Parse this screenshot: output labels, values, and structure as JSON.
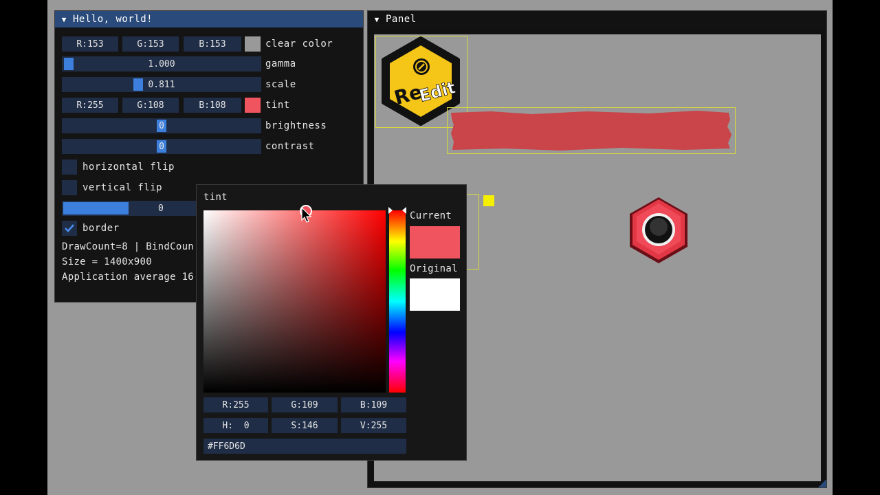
{
  "window1": {
    "title": "Hello, world!",
    "clear_color": {
      "r": "R:153",
      "g": "G:153",
      "b": "B:153",
      "label": "clear color",
      "swatch": "#999999"
    },
    "gamma": {
      "value": "1.000",
      "label": "gamma",
      "fraction": 0.0
    },
    "scale": {
      "value": "0.811",
      "label": "scale",
      "fraction": 0.39
    },
    "tint": {
      "r": "R:255",
      "g": "G:108",
      "b": "B:108",
      "label": "tint",
      "swatch": "#f0555f"
    },
    "brightness": {
      "value": "0",
      "label": "brightness",
      "fraction": 0.5
    },
    "contrast": {
      "value": "0",
      "label": "contrast",
      "fraction": 0.5
    },
    "horizontal_flip": {
      "label": "horizontal flip",
      "checked": false
    },
    "vertical_flip": {
      "label": "vertical flip",
      "checked": false
    },
    "progress": {
      "value": "0",
      "fraction": 0.33
    },
    "border": {
      "label": "border",
      "checked": true
    },
    "drawcount": "DrawCount=8 | BindCoun",
    "size": "Size = 1400x900",
    "app_avg": "Application average 16"
  },
  "window2": {
    "title": "Panel",
    "logo": {
      "text1": "Re",
      "text2": "Edit"
    }
  },
  "picker": {
    "title": "tint",
    "current_label": "Current",
    "original_label": "Original",
    "current_color": "#f0555f",
    "original_color": "#ffffff",
    "hue_color": "#ff0000",
    "rgb": {
      "r": "R:255",
      "g": "G:109",
      "b": "B:109"
    },
    "hsv": {
      "h": "H:  0",
      "s": "S:146",
      "v": "V:255"
    },
    "hex": "#FF6D6D"
  }
}
